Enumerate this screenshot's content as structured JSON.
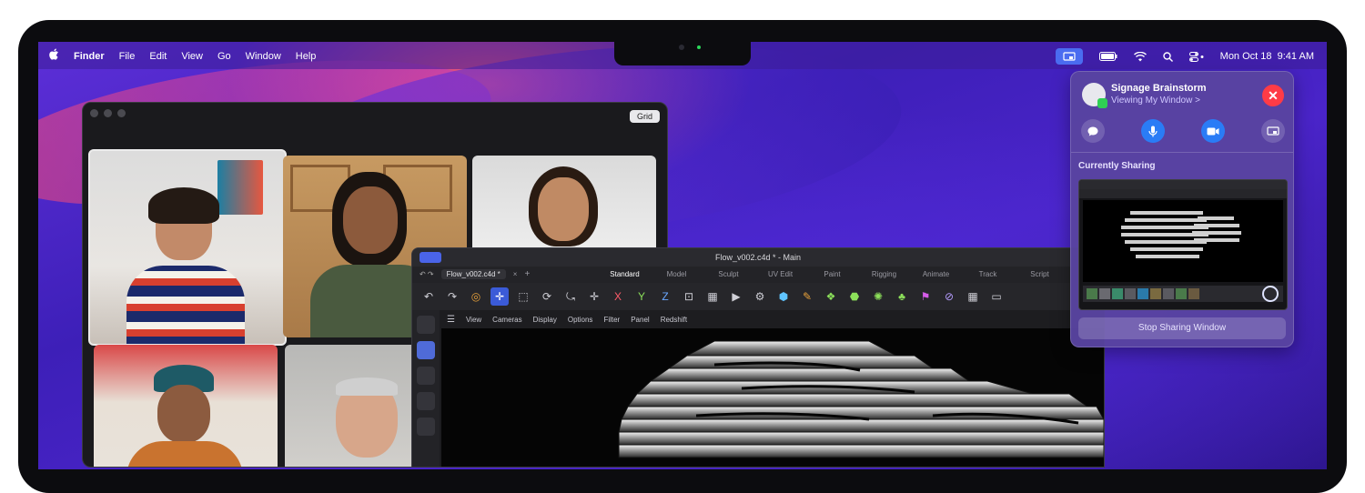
{
  "menubar": {
    "apple": "",
    "app_name": "Finder",
    "items": [
      "File",
      "Edit",
      "View",
      "Go",
      "Window",
      "Help"
    ],
    "clock": "Mon Oct 18  9:41 AM"
  },
  "facetime": {
    "grid_label": "Grid"
  },
  "c4d": {
    "title": "Flow_v002.c4d * - Main",
    "doc_tab": "Flow_v002.c4d *",
    "doc_close": "×",
    "add_tab": "+",
    "layouts": [
      "Standard",
      "Model",
      "Sculpt",
      "UV Edit",
      "Paint",
      "Rigging",
      "Animate",
      "Track",
      "Script"
    ],
    "axis_x": "X",
    "axis_y": "Y",
    "axis_z": "Z",
    "view_menu": [
      "View",
      "Cameras",
      "Display",
      "Options",
      "Filter",
      "Panel",
      "Redshift"
    ]
  },
  "share_panel": {
    "title": "Signage Brainstorm",
    "subtitle": "Viewing My Window >",
    "close_symbol": "✕",
    "section_label": "Currently Sharing",
    "stop_label": "Stop Sharing Window"
  },
  "colors": {
    "accent_blue": "#2a7cf6",
    "close_red": "#ff3b46",
    "facetime_green": "#2fcf55"
  }
}
